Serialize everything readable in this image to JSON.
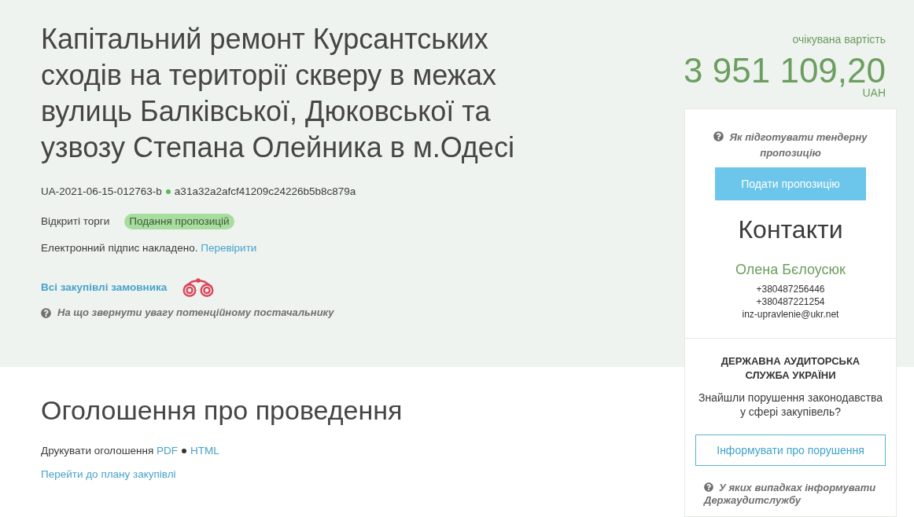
{
  "tender": {
    "title": "Капітальний ремонт Курсантських сходів на території скверу в межах вулиць Балківської, Дюковської та узвозу Степана Олейника в м.Одесі",
    "id": "UA-2021-06-15-012763-b",
    "hash": "a31a32a2afcf41209c24226b5b8c879a",
    "procedure": "Відкриті торги",
    "status": "Подання пропозицій",
    "signature": {
      "text": "Електронний підпис накладено.",
      "link": "Перевірити"
    },
    "customer_link": "Всі закупівлі замовника",
    "supplier_hint": "На що звернути увагу потенційному постачальнику"
  },
  "price": {
    "label": "очікувана вартість",
    "amount": "3 951 109,20",
    "currency": "UAH"
  },
  "sidebar": {
    "help_link": "Як підготувати тендерну пропозицію",
    "submit_button": "Подати пропозицію",
    "contacts": {
      "heading": "Контакти",
      "name": "Олена Бєлоусюк",
      "phones": [
        "+380487256446",
        "+380487221254"
      ],
      "email": "inz-upravlenie@ukr.net"
    },
    "audit": {
      "title": "ДЕРЖАВНА АУДИТОРСЬКА СЛУЖБА УКРАЇНИ",
      "question": "Знайшли порушення законодавства у сфері закупівель?",
      "report_button": "Інформувати про порушення",
      "help_link": "У яких випадках інформувати Держаудитслужбу"
    }
  },
  "announcement": {
    "heading": "Оголошення про проведення",
    "print_label": "Друкувати оголошення",
    "print_links": [
      "PDF",
      "HTML"
    ],
    "plan_link": "Перейти до плану закупівлі"
  }
}
